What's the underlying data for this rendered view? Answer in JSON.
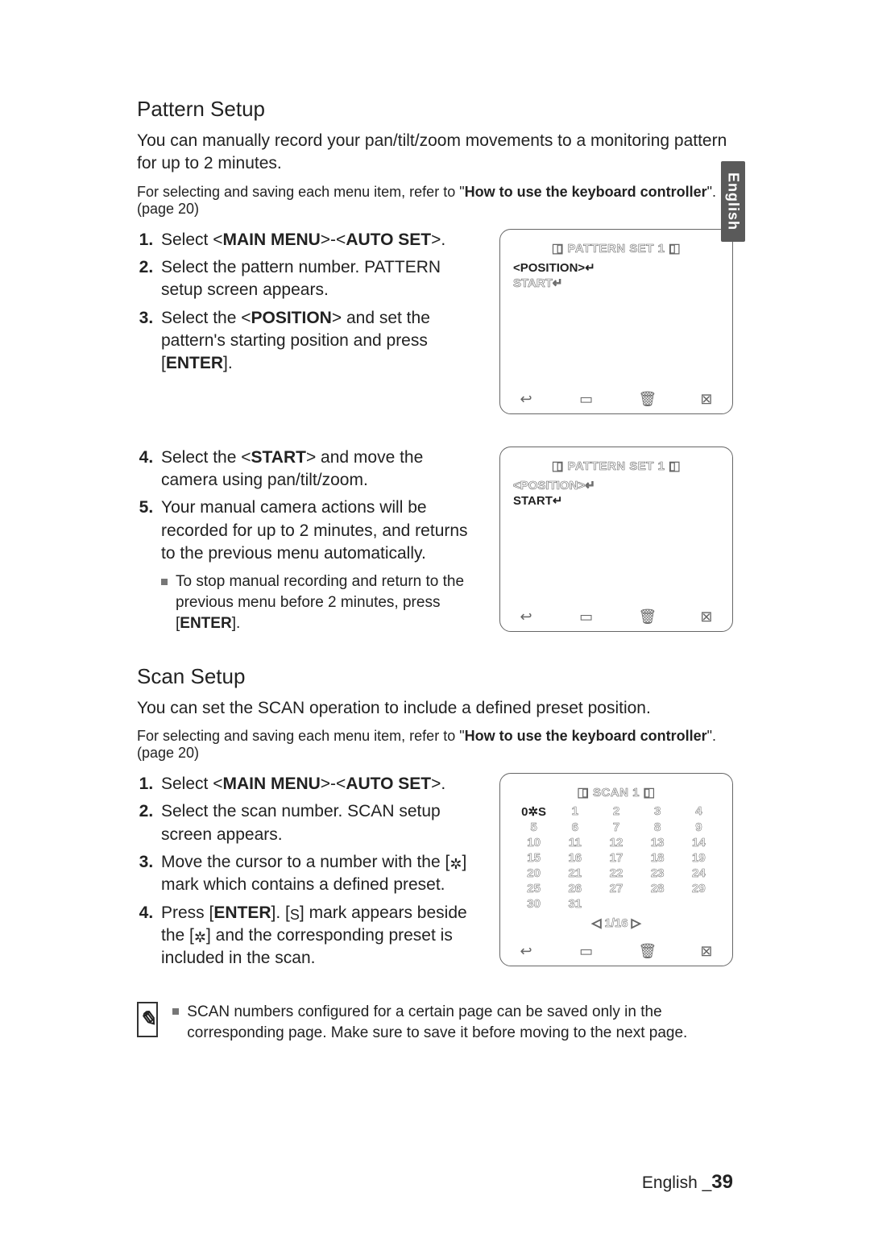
{
  "lang_tab": "English",
  "section1": {
    "heading": "Pattern Setup",
    "intro": "You can manually record your pan/tilt/zoom movements to a monitoring pattern for up to 2 minutes.",
    "subnote_prefix": "For selecting and saving each menu item, refer to \"",
    "subnote_bold": "How to use the keyboard controller",
    "subnote_suffix": "\". (page 20)",
    "steps_a": {
      "s1_pre": "Select <",
      "s1_b1": "MAIN MENU",
      "s1_mid": ">-<",
      "s1_b2": "AUTO SET",
      "s1_post": ">.",
      "s2": "Select the pattern number. PATTERN setup screen appears.",
      "s3_pre": "Select the <",
      "s3_b": "POSITION",
      "s3_mid": "> and set the pattern's starting position and press [",
      "s3_b2": "ENTER",
      "s3_post": "]."
    },
    "steps_b": {
      "s4_pre": "Select the <",
      "s4_b": "START",
      "s4_post": "> and move the camera using pan/tilt/zoom.",
      "s5": "Your manual camera actions will be recorded for up to 2 minutes, and returns to the previous menu automatically.",
      "sub_pre": "To stop manual recording and return to the previous menu before 2 minutes, press [",
      "sub_b": "ENTER",
      "sub_post": "]."
    },
    "osd1": {
      "title": "◧ PATTERN SET 1 ◨",
      "line1": "<POSITION>↵",
      "line2": "START↵"
    },
    "osd2": {
      "title": "◧ PATTERN SET 1 ◨",
      "line1": "<POSITION>↵",
      "line2": "START↵"
    }
  },
  "section2": {
    "heading": "Scan Setup",
    "intro": "You can set the SCAN operation to include a defined preset position.",
    "subnote_prefix": "For selecting and saving each menu item, refer to \"",
    "subnote_bold": "How to use the keyboard controller",
    "subnote_suffix": "\". (page 20)",
    "steps": {
      "s1_pre": "Select <",
      "s1_b1": "MAIN MENU",
      "s1_mid": ">-<",
      "s1_b2": "AUTO SET",
      "s1_post": ">.",
      "s2": "Select the scan number. SCAN setup screen appears.",
      "s3_pre": "Move the cursor to a number with the [",
      "s3_glyph": "✲",
      "s3_post": "] mark which contains a defined preset.",
      "s4_pre": "Press [",
      "s4_b": "ENTER",
      "s4_mid1": "]. [",
      "s4_glyph1": "S",
      "s4_mid2": "] mark appears beside the [",
      "s4_glyph2": "✲",
      "s4_post": "] and the corresponding preset is included in the scan."
    },
    "osd": {
      "title": "◧ SCAN 1 ◨",
      "first_cell": "0✲S",
      "cells": [
        "1",
        "2",
        "3",
        "4",
        "5",
        "6",
        "7",
        "8",
        "9",
        "10",
        "11",
        "12",
        "13",
        "14",
        "15",
        "16",
        "17",
        "18",
        "19",
        "20",
        "21",
        "22",
        "23",
        "24",
        "25",
        "26",
        "27",
        "28",
        "29",
        "30",
        "31"
      ],
      "page_ind": "◁ 1/16 ▷"
    },
    "note": "SCAN numbers configured for a certain page can be saved only in the corresponding page. Make sure to save it before moving to the next page."
  },
  "icons": {
    "back": "↩",
    "save": "▭",
    "delete": "🗑",
    "close": "⊠"
  },
  "footer": {
    "lang": "English _",
    "page": "39"
  },
  "note_icon": "✎"
}
